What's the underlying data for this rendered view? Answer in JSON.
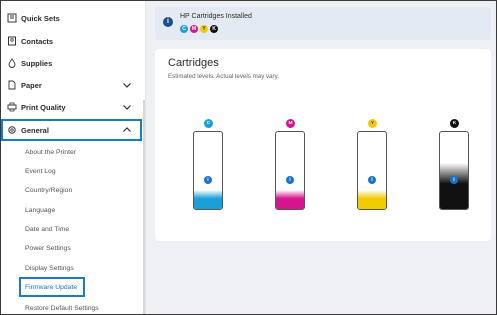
{
  "sidebar": {
    "items": [
      {
        "label": "Quick Sets",
        "icon": "quick-sets-icon"
      },
      {
        "label": "Contacts",
        "icon": "contacts-icon"
      },
      {
        "label": "Supplies",
        "icon": "supplies-icon"
      },
      {
        "label": "Paper",
        "icon": "paper-icon"
      },
      {
        "label": "Print Quality",
        "icon": "print-quality-icon"
      },
      {
        "label": "General",
        "icon": "gear-icon"
      }
    ],
    "general_sub": [
      "About the Printer",
      "Event Log",
      "Country/Region",
      "Language",
      "Date and Time",
      "Power Settings",
      "Display Settings",
      "Firmware Update",
      "Restore Default Settings"
    ]
  },
  "banner": {
    "title": "HP Cartridges Installed",
    "info_glyph": "i"
  },
  "cartridges": {
    "title": "Cartridges",
    "subtitle": "Estimated levels. Actual levels may vary.",
    "items": [
      {
        "letter": "C",
        "color": "#1aa0d8",
        "level": 0.25
      },
      {
        "letter": "M",
        "color": "#d6148c",
        "level": 0.25
      },
      {
        "letter": "Y",
        "color": "#f0cc00",
        "level": 0.25
      },
      {
        "letter": "K",
        "color": "#111111",
        "level": 0.6
      }
    ]
  },
  "colors": {
    "accent": "#1a7bbf",
    "cyan": "#1aa0d8",
    "magenta": "#d6148c",
    "yellow": "#f0cc00",
    "black": "#111111"
  }
}
